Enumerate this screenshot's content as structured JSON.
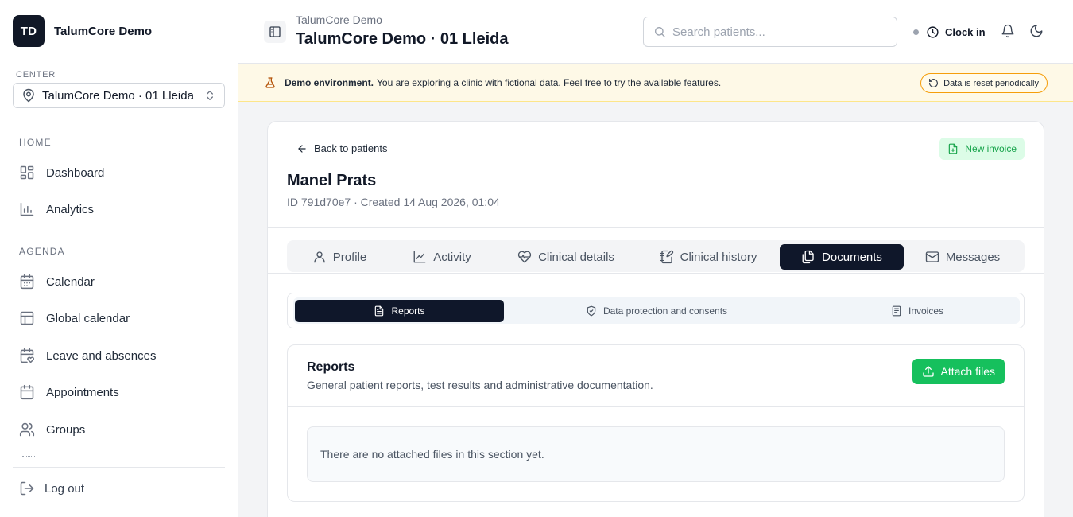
{
  "brand": {
    "initials": "TD",
    "name": "TalumCore Demo"
  },
  "center": {
    "label": "CENTER",
    "value": "TalumCore Demo · 01 Lleida"
  },
  "sidebar": {
    "sections": [
      {
        "label": "HOME",
        "items": [
          {
            "label": "Dashboard",
            "icon": "dashboard-icon"
          },
          {
            "label": "Analytics",
            "icon": "analytics-icon"
          }
        ]
      },
      {
        "label": "AGENDA",
        "items": [
          {
            "label": "Calendar",
            "icon": "calendar-icon"
          },
          {
            "label": "Global calendar",
            "icon": "global-calendar-icon"
          },
          {
            "label": "Leave and absences",
            "icon": "calendar-heart-icon"
          },
          {
            "label": "Appointments",
            "icon": "calendar-icon"
          },
          {
            "label": "Groups",
            "icon": "users-icon"
          }
        ]
      }
    ],
    "logout": "Log out"
  },
  "header": {
    "subtitle": "TalumCore Demo",
    "title": "TalumCore Demo · 01 Lleida",
    "search_placeholder": "Search patients...",
    "clock_label": "Clock in"
  },
  "banner": {
    "bold": "Demo environment.",
    "text": "You are exploring a clinic with fictional data. Feel free to try the available features.",
    "pill": "Data is reset periodically"
  },
  "patient": {
    "back_label": "Back to patients",
    "new_invoice_label": "New invoice",
    "name": "Manel Prats",
    "meta": "ID 791d70e7 · Created 14 Aug 2026, 01:04"
  },
  "tabs": [
    {
      "label": "Profile",
      "icon": "user-icon",
      "active": false
    },
    {
      "label": "Activity",
      "icon": "chart-line-icon",
      "active": false
    },
    {
      "label": "Clinical details",
      "icon": "heart-pulse-icon",
      "active": false
    },
    {
      "label": "Clinical history",
      "icon": "notebook-pen-icon",
      "active": false
    },
    {
      "label": "Documents",
      "icon": "files-icon",
      "active": true
    },
    {
      "label": "Messages",
      "icon": "mail-icon",
      "active": false
    }
  ],
  "subtabs": [
    {
      "label": "Reports",
      "icon": "file-text-icon",
      "active": true
    },
    {
      "label": "Data protection and consents",
      "icon": "shield-check-icon",
      "active": false
    },
    {
      "label": "Invoices",
      "icon": "receipt-icon",
      "active": false
    }
  ],
  "reports": {
    "title": "Reports",
    "description": "General patient reports, test results and administrative documentation.",
    "attach_label": "Attach files",
    "empty_text": "There are no attached files in this section yet."
  }
}
